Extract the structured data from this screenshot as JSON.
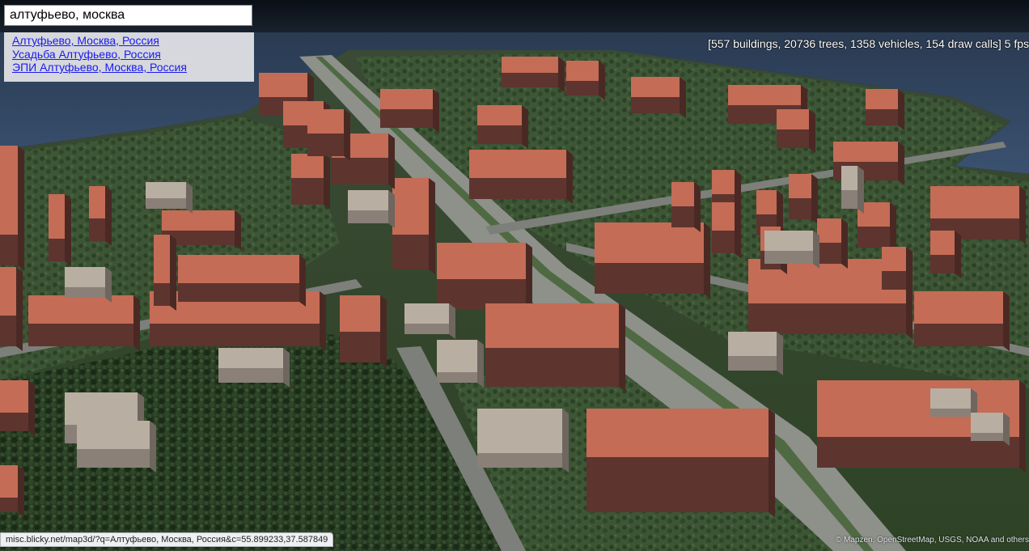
{
  "search": {
    "value": "алтуфьево, москва"
  },
  "suggestions": [
    {
      "label": "Алтуфьево, Москва, Россия"
    },
    {
      "label": "Усадьба Алтуфьево, Россия"
    },
    {
      "label": "ЭПИ Алтуфьево, Москва, Россия"
    }
  ],
  "stats": {
    "text": "[557 buildings, 20736 trees, 1358 vehicles, 154 draw calls] 5 fps"
  },
  "status_url": "misc.blicky.net/map3d/?q=Алтуфьево, Москва, Россия&c=55.899233,37.587849",
  "attribution": "© Mapzen, OpenStreetMap, USGS, NOAA and others",
  "colors": {
    "water": "#2c3e54",
    "sky": "#121922",
    "grass": "#3f5a33",
    "trees": "#22351f",
    "road": "#8b8d88",
    "building_wall": "#6b3c35",
    "building_roof": "#c46c56",
    "link": "#1a1aee"
  }
}
